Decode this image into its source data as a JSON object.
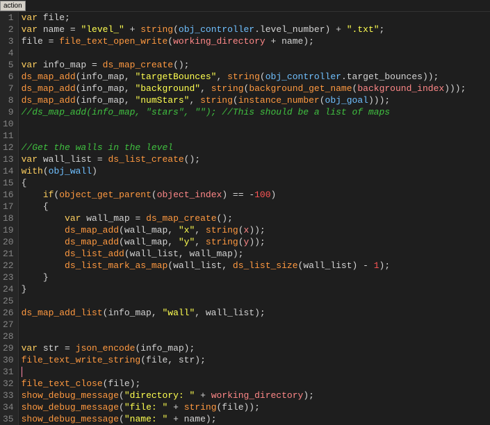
{
  "titlebar": {
    "label": "action"
  },
  "line_count": 35,
  "code_lines": [
    [
      {
        "t": "var ",
        "c": "kw"
      },
      {
        "t": "file;",
        "c": "op"
      }
    ],
    [
      {
        "t": "var ",
        "c": "kw"
      },
      {
        "t": "name = ",
        "c": "op"
      },
      {
        "t": "\"level_\"",
        "c": "str"
      },
      {
        "t": " + ",
        "c": "op"
      },
      {
        "t": "string",
        "c": "fn"
      },
      {
        "t": "(",
        "c": "op"
      },
      {
        "t": "obj_controller",
        "c": "obj"
      },
      {
        "t": ".level_number) + ",
        "c": "op"
      },
      {
        "t": "\".txt\"",
        "c": "str"
      },
      {
        "t": ";",
        "c": "op"
      }
    ],
    [
      {
        "t": "file = ",
        "c": "op"
      },
      {
        "t": "file_text_open_write",
        "c": "fn"
      },
      {
        "t": "(",
        "c": "op"
      },
      {
        "t": "working_directory",
        "c": "builtin"
      },
      {
        "t": " + name);",
        "c": "op"
      }
    ],
    [],
    [
      {
        "t": "var ",
        "c": "kw"
      },
      {
        "t": "info_map = ",
        "c": "op"
      },
      {
        "t": "ds_map_create",
        "c": "fn"
      },
      {
        "t": "();",
        "c": "op"
      }
    ],
    [
      {
        "t": "ds_map_add",
        "c": "fn"
      },
      {
        "t": "(info_map, ",
        "c": "op"
      },
      {
        "t": "\"targetBounces\"",
        "c": "str"
      },
      {
        "t": ", ",
        "c": "op"
      },
      {
        "t": "string",
        "c": "fn"
      },
      {
        "t": "(",
        "c": "op"
      },
      {
        "t": "obj_controller",
        "c": "obj"
      },
      {
        "t": ".target_bounces));",
        "c": "op"
      }
    ],
    [
      {
        "t": "ds_map_add",
        "c": "fn"
      },
      {
        "t": "(info_map, ",
        "c": "op"
      },
      {
        "t": "\"background\"",
        "c": "str"
      },
      {
        "t": ", ",
        "c": "op"
      },
      {
        "t": "string",
        "c": "fn"
      },
      {
        "t": "(",
        "c": "op"
      },
      {
        "t": "background_get_name",
        "c": "fn"
      },
      {
        "t": "(",
        "c": "op"
      },
      {
        "t": "background_index",
        "c": "builtin"
      },
      {
        "t": ")));",
        "c": "op"
      }
    ],
    [
      {
        "t": "ds_map_add",
        "c": "fn"
      },
      {
        "t": "(info_map, ",
        "c": "op"
      },
      {
        "t": "\"numStars\"",
        "c": "str"
      },
      {
        "t": ", ",
        "c": "op"
      },
      {
        "t": "string",
        "c": "fn"
      },
      {
        "t": "(",
        "c": "op"
      },
      {
        "t": "instance_number",
        "c": "fn"
      },
      {
        "t": "(",
        "c": "op"
      },
      {
        "t": "obj_goal",
        "c": "obj"
      },
      {
        "t": ")));",
        "c": "op"
      }
    ],
    [
      {
        "t": "//ds_map_add(info_map, \"stars\", \"\"); //This should be a list of maps",
        "c": "cmt"
      }
    ],
    [],
    [],
    [
      {
        "t": "//Get the walls in the level",
        "c": "cmt"
      }
    ],
    [
      {
        "t": "var ",
        "c": "kw"
      },
      {
        "t": "wall_list = ",
        "c": "op"
      },
      {
        "t": "ds_list_create",
        "c": "fn"
      },
      {
        "t": "();",
        "c": "op"
      }
    ],
    [
      {
        "t": "with",
        "c": "kw"
      },
      {
        "t": "(",
        "c": "op"
      },
      {
        "t": "obj_wall",
        "c": "obj"
      },
      {
        "t": ")",
        "c": "op"
      }
    ],
    [
      {
        "t": "{",
        "c": "op"
      }
    ],
    [
      {
        "t": "    ",
        "c": "op"
      },
      {
        "t": "if",
        "c": "kw"
      },
      {
        "t": "(",
        "c": "op"
      },
      {
        "t": "object_get_parent",
        "c": "fn"
      },
      {
        "t": "(",
        "c": "op"
      },
      {
        "t": "object_index",
        "c": "builtin"
      },
      {
        "t": ") == -",
        "c": "op"
      },
      {
        "t": "100",
        "c": "num"
      },
      {
        "t": ")",
        "c": "op"
      }
    ],
    [
      {
        "t": "    {",
        "c": "op"
      }
    ],
    [
      {
        "t": "        ",
        "c": "op"
      },
      {
        "t": "var ",
        "c": "kw"
      },
      {
        "t": "wall_map = ",
        "c": "op"
      },
      {
        "t": "ds_map_create",
        "c": "fn"
      },
      {
        "t": "();",
        "c": "op"
      }
    ],
    [
      {
        "t": "        ",
        "c": "op"
      },
      {
        "t": "ds_map_add",
        "c": "fn"
      },
      {
        "t": "(wall_map, ",
        "c": "op"
      },
      {
        "t": "\"x\"",
        "c": "str"
      },
      {
        "t": ", ",
        "c": "op"
      },
      {
        "t": "string",
        "c": "fn"
      },
      {
        "t": "(",
        "c": "op"
      },
      {
        "t": "x",
        "c": "builtin"
      },
      {
        "t": "));",
        "c": "op"
      }
    ],
    [
      {
        "t": "        ",
        "c": "op"
      },
      {
        "t": "ds_map_add",
        "c": "fn"
      },
      {
        "t": "(wall_map, ",
        "c": "op"
      },
      {
        "t": "\"y\"",
        "c": "str"
      },
      {
        "t": ", ",
        "c": "op"
      },
      {
        "t": "string",
        "c": "fn"
      },
      {
        "t": "(",
        "c": "op"
      },
      {
        "t": "y",
        "c": "builtin"
      },
      {
        "t": "));",
        "c": "op"
      }
    ],
    [
      {
        "t": "        ",
        "c": "op"
      },
      {
        "t": "ds_list_add",
        "c": "fn"
      },
      {
        "t": "(wall_list, wall_map);",
        "c": "op"
      }
    ],
    [
      {
        "t": "        ",
        "c": "op"
      },
      {
        "t": "ds_list_mark_as_map",
        "c": "fn"
      },
      {
        "t": "(wall_list, ",
        "c": "op"
      },
      {
        "t": "ds_list_size",
        "c": "fn"
      },
      {
        "t": "(wall_list) - ",
        "c": "op"
      },
      {
        "t": "1",
        "c": "num"
      },
      {
        "t": ");",
        "c": "op"
      }
    ],
    [
      {
        "t": "    }",
        "c": "op"
      }
    ],
    [
      {
        "t": "}",
        "c": "op"
      }
    ],
    [],
    [
      {
        "t": "ds_map_add_list",
        "c": "fn"
      },
      {
        "t": "(info_map, ",
        "c": "op"
      },
      {
        "t": "\"wall\"",
        "c": "str"
      },
      {
        "t": ", wall_list);",
        "c": "op"
      }
    ],
    [],
    [],
    [
      {
        "t": "var ",
        "c": "kw"
      },
      {
        "t": "str = ",
        "c": "op"
      },
      {
        "t": "json_encode",
        "c": "fn"
      },
      {
        "t": "(info_map);",
        "c": "op"
      }
    ],
    [
      {
        "t": "file_text_write_string",
        "c": "fn"
      },
      {
        "t": "(file, str);",
        "c": "op"
      }
    ],
    [
      {
        "t": "",
        "c": "op",
        "caret": true
      }
    ],
    [
      {
        "t": "file_text_close",
        "c": "fn"
      },
      {
        "t": "(file);",
        "c": "op"
      }
    ],
    [
      {
        "t": "show_debug_message",
        "c": "fn"
      },
      {
        "t": "(",
        "c": "op"
      },
      {
        "t": "\"directory: \"",
        "c": "str"
      },
      {
        "t": " + ",
        "c": "op"
      },
      {
        "t": "working_directory",
        "c": "builtin"
      },
      {
        "t": ");",
        "c": "op"
      }
    ],
    [
      {
        "t": "show_debug_message",
        "c": "fn"
      },
      {
        "t": "(",
        "c": "op"
      },
      {
        "t": "\"file: \"",
        "c": "str"
      },
      {
        "t": " + ",
        "c": "op"
      },
      {
        "t": "string",
        "c": "fn"
      },
      {
        "t": "(file));",
        "c": "op"
      }
    ],
    [
      {
        "t": "show_debug_message",
        "c": "fn"
      },
      {
        "t": "(",
        "c": "op"
      },
      {
        "t": "\"name: \"",
        "c": "str"
      },
      {
        "t": " + name);",
        "c": "op"
      }
    ]
  ]
}
